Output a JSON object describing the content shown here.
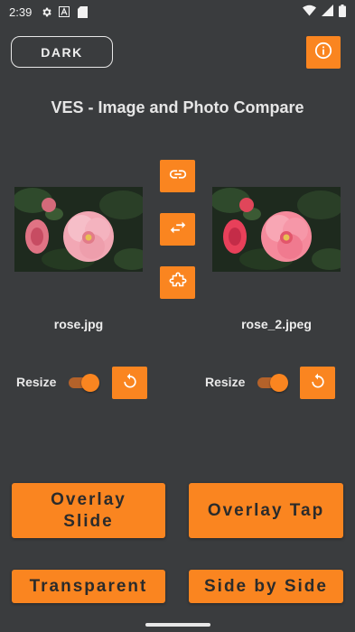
{
  "status_bar": {
    "time": "2:39"
  },
  "header": {
    "theme_button_label": "DARK",
    "title": "VES - Image and Photo Compare"
  },
  "images": {
    "left": {
      "filename": "rose.jpg"
    },
    "right": {
      "filename": "rose_2.jpeg"
    }
  },
  "controls": {
    "left": {
      "resize_label": "Resize",
      "resize_on": true
    },
    "right": {
      "resize_label": "Resize",
      "resize_on": true
    }
  },
  "actions": {
    "overlay_slide": "Overlay Slide",
    "overlay_tap": "Overlay Tap",
    "transparent": "Transparent",
    "side_by_side": "Side by Side"
  },
  "colors": {
    "background": "#3a3c3e",
    "accent": "#fa8520"
  },
  "icons": [
    "settings-icon",
    "font-icon",
    "sd-card-icon",
    "wifi-icon",
    "signal-icon",
    "battery-icon",
    "info-icon",
    "link-icon",
    "swap-icon",
    "puzzle-icon",
    "reset-icon"
  ]
}
